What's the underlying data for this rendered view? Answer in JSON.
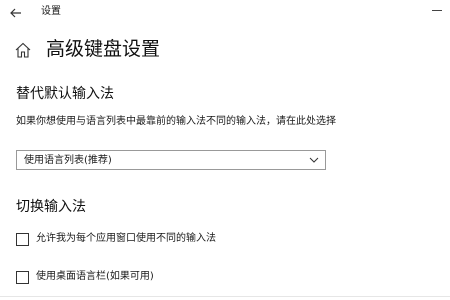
{
  "titlebar": {
    "title": "设置"
  },
  "header": {
    "page_title": "高级键盘设置"
  },
  "sections": [
    {
      "heading": "替代默认输入法",
      "description": "如果你想使用与语言列表中最靠前的输入法不同的输入法，请在此处选择",
      "dropdown": {
        "selected": "使用语言列表(推荐)"
      }
    },
    {
      "heading": "切换输入法",
      "checkboxes": [
        {
          "label": "允许我为每个应用窗口使用不同的输入法",
          "checked": false
        },
        {
          "label": "使用桌面语言栏(如果可用)",
          "checked": false
        }
      ]
    }
  ],
  "icons": {
    "back": "back-arrow-icon",
    "home": "home-icon",
    "dropdown": "chevron-down-icon",
    "minimize": "minimize-icon"
  }
}
